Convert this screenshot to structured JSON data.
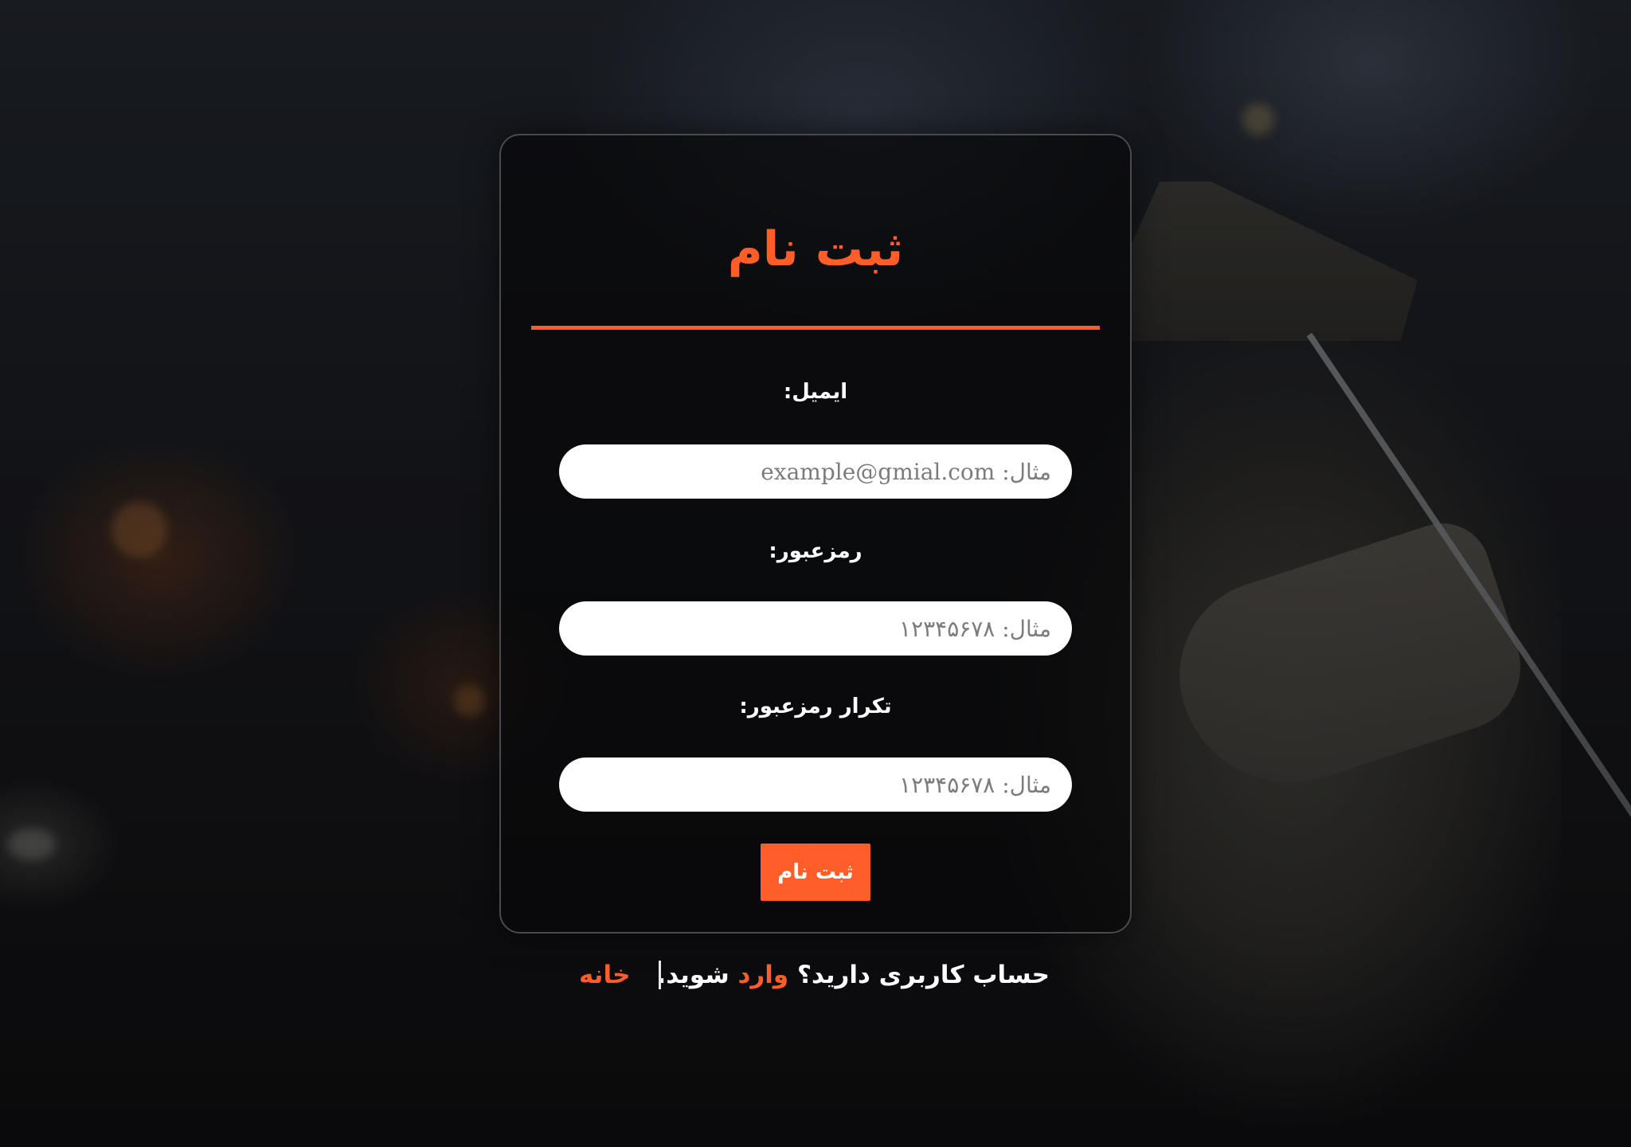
{
  "page": {
    "accent_color": "#ff5e2b"
  },
  "form": {
    "title": "ثبت نام",
    "email_label": "ایمیل:",
    "email_placeholder": "مثال: example@gmial.com",
    "email_value": "",
    "password_label": "رمزعبور:",
    "password_placeholder": "مثال: ۱۲۳۴۵۶۷۸",
    "password_value": "",
    "confirm_label": "تکرار رمزعبور:",
    "confirm_placeholder": "مثال: ۱۲۳۴۵۶۷۸",
    "confirm_value": "",
    "submit_label": "ثبت نام"
  },
  "footer": {
    "question_text": "حساب کاربری دارید؟",
    "login_link": "وارد",
    "login_suffix": "شوید.",
    "home_link": "خانه"
  }
}
